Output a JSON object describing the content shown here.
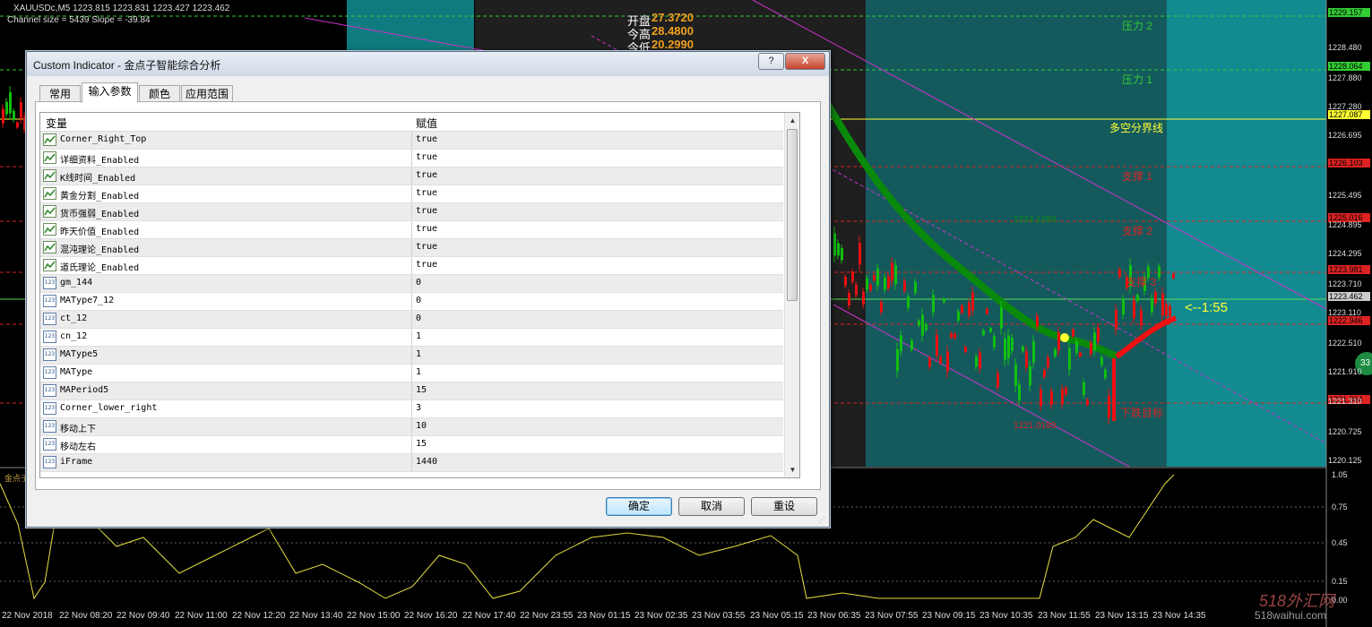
{
  "chart": {
    "symbol_header": "XAUUSDc,M5  1223.815 1223.831 1223.427 1223.462",
    "channel_info": "Channel size = 5439 Slope = -39.84",
    "open_today": {
      "label": "开盘",
      "value": "27.3720"
    },
    "today_high": {
      "label": "今高",
      "value": "28.4800"
    },
    "today_low": {
      "label": "今低",
      "value": "20.2990"
    },
    "levels": {
      "pressure2": "压力 2",
      "pressure1": "压力 1",
      "bull_bear_line": "多空分界线",
      "support1": "支撑 1",
      "support2": "支撑 2",
      "support3": "支撑 3",
      "target": "下跌目标",
      "low_label": "1221.0183",
      "mid_label": "1224.1293"
    },
    "countdown": "<--1:55",
    "bubble": "33",
    "indicator_name": "金点子",
    "price_axis": [
      "1229.157",
      "1228.480",
      "1228.064",
      "1227.880",
      "1227.280",
      "1227.087",
      "1226.695",
      "1226.103",
      "1225.495",
      "1225.016",
      "1224.895",
      "1224.295",
      "1223.981",
      "1223.710",
      "1223.462",
      "1223.110",
      "1222.946",
      "1222.510",
      "1221.910",
      "1221.364",
      "1221.310",
      "1220.725",
      "1220.125"
    ],
    "osc_axis": [
      "1.05",
      "0.75",
      "0.45",
      "0.15",
      "0.00"
    ],
    "time_axis": [
      "22 Nov 2018",
      "22 Nov 08:20",
      "22 Nov 09:40",
      "22 Nov 11:00",
      "22 Nov 12:20",
      "22 Nov 13:40",
      "22 Nov 15:00",
      "22 Nov 16:20",
      "22 Nov 17:40",
      "22 Nov 23:55",
      "23 Nov 01:15",
      "23 Nov 02:35",
      "23 Nov 03:55",
      "23 Nov 05:15",
      "23 Nov 06:35",
      "23 Nov 07:55",
      "23 Nov 09:15",
      "23 Nov 10:35",
      "23 Nov 11:55",
      "23 Nov 13:15",
      "23 Nov 14:35"
    ],
    "watermark": "518外汇网",
    "watermark_url": "518waihui.com",
    "colors": {
      "up": "#00cc00",
      "down": "#ff0000",
      "teal": "#0f7b7f",
      "highlight": "#18a9ad",
      "level_green": "#33cc33",
      "level_yellow": "#ffff33",
      "magenta": "#cc33cc"
    }
  },
  "dialog": {
    "title": "Custom Indicator - 金点子智能综合分析",
    "help_button": "?",
    "close_button": "X",
    "tabs": [
      {
        "label": "常用"
      },
      {
        "label": "输入参数"
      },
      {
        "label": "颜色"
      },
      {
        "label": "应用范围"
      }
    ],
    "grid_headers": {
      "variable": "变量",
      "value": "赋值"
    },
    "params": [
      {
        "name": "Corner_Right_Top",
        "value": "true",
        "icon": "bool-icon"
      },
      {
        "name": "详细资料_Enabled",
        "value": "true",
        "icon": "bool-icon"
      },
      {
        "name": "K线时间_Enabled",
        "value": "true",
        "icon": "bool-icon"
      },
      {
        "name": "黄金分割_Enabled",
        "value": "true",
        "icon": "bool-icon"
      },
      {
        "name": "货币强弱_Enabled",
        "value": "true",
        "icon": "bool-icon"
      },
      {
        "name": "昨天价值_Enabled",
        "value": "true",
        "icon": "bool-icon"
      },
      {
        "name": "混沌理论_Enabled",
        "value": "true",
        "icon": "bool-icon"
      },
      {
        "name": "道氏理论_Enabled",
        "value": "true",
        "icon": "bool-icon"
      },
      {
        "name": "gm_144",
        "value": "0",
        "icon": "number-icon"
      },
      {
        "name": "MAType7_12",
        "value": "0",
        "icon": "number-icon"
      },
      {
        "name": "ct_12",
        "value": "0",
        "icon": "number-icon"
      },
      {
        "name": "cn_12",
        "value": "1",
        "icon": "number-icon"
      },
      {
        "name": "MAType5",
        "value": "1",
        "icon": "number-icon"
      },
      {
        "name": "MAType",
        "value": "1",
        "icon": "number-icon"
      },
      {
        "name": "MAPeriod5",
        "value": "15",
        "icon": "number-icon"
      },
      {
        "name": "Corner_lower_right",
        "value": "3",
        "icon": "number-icon"
      },
      {
        "name": "移动上下",
        "value": "10",
        "icon": "number-icon"
      },
      {
        "name": "移动左右",
        "value": "15",
        "icon": "number-icon"
      },
      {
        "name": "iFrame",
        "value": "1440",
        "icon": "number-icon"
      }
    ],
    "buttons": {
      "ok": "确定",
      "cancel": "取消",
      "reset": "重设"
    }
  }
}
